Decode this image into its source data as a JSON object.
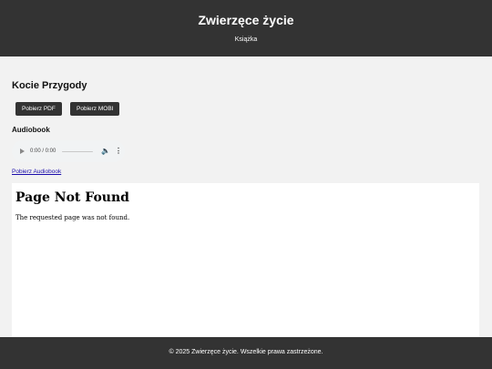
{
  "header": {
    "title": "Zwierzęce życie",
    "subtitle": "Książka"
  },
  "book": {
    "title": "Kocie Przygody",
    "pdf_label": "Pobierz PDF",
    "mobi_label": "Pobierz MOBI"
  },
  "audio": {
    "heading": "Audiobook",
    "time": "0:00 / 0:00",
    "progress": 0,
    "play_icon": "play-icon",
    "volume_icon": "volume-icon",
    "more_icon": "more-options-icon",
    "link_label": "Pobierz Audiobook"
  },
  "frame": {
    "title": "Page Not Found",
    "message": "The requested page was not found."
  },
  "footer": {
    "text": "© 2025 Zwierzęce życie. Wszelkie prawa zastrzeżone."
  },
  "colors": {
    "header_bg": "#333333",
    "page_bg": "#f2f2f2",
    "button_bg": "#333333",
    "link": "#1a0dab"
  }
}
